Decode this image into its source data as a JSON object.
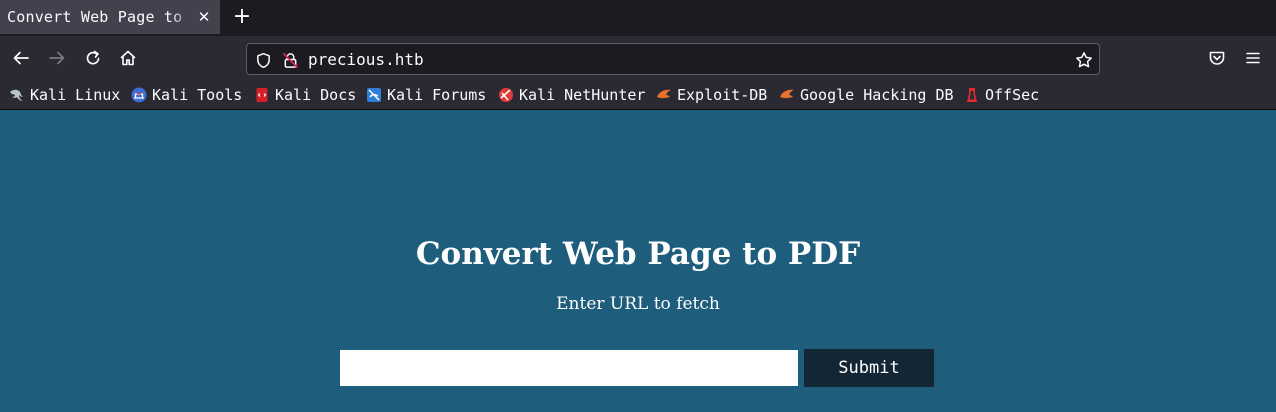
{
  "tab": {
    "title": "Convert Web Page to PDF",
    "close_glyph": "✕",
    "new_tab_glyph": "+"
  },
  "navbar": {
    "url": "precious.htb",
    "icons": [
      "back-icon",
      "forward-icon",
      "reload-icon",
      "home-icon",
      "shield-icon",
      "insecure-lock-icon",
      "star-icon",
      "pocket-icon",
      "menu-icon"
    ]
  },
  "bookmarks": [
    {
      "label": "Kali Linux",
      "icon": "kali-dragon-icon"
    },
    {
      "label": "Kali Tools",
      "icon": "kali-tools-icon"
    },
    {
      "label": "Kali Docs",
      "icon": "kali-docs-icon"
    },
    {
      "label": "Kali Forums",
      "icon": "kali-forums-icon"
    },
    {
      "label": "Kali NetHunter",
      "icon": "kali-nethunter-icon"
    },
    {
      "label": "Exploit-DB",
      "icon": "exploit-db-icon"
    },
    {
      "label": "Google Hacking DB",
      "icon": "ghdb-icon"
    },
    {
      "label": "OffSec",
      "icon": "offsec-icon"
    }
  ],
  "page": {
    "title": "Convert Web Page to PDF",
    "subtitle": "Enter URL to fetch",
    "input_value": "",
    "submit_label": "Submit"
  },
  "colors": {
    "page_background": "#1e5d7b",
    "submit_background": "#142633",
    "toolbar": "#2b2a33",
    "tabstrip": "#1c1b22"
  }
}
